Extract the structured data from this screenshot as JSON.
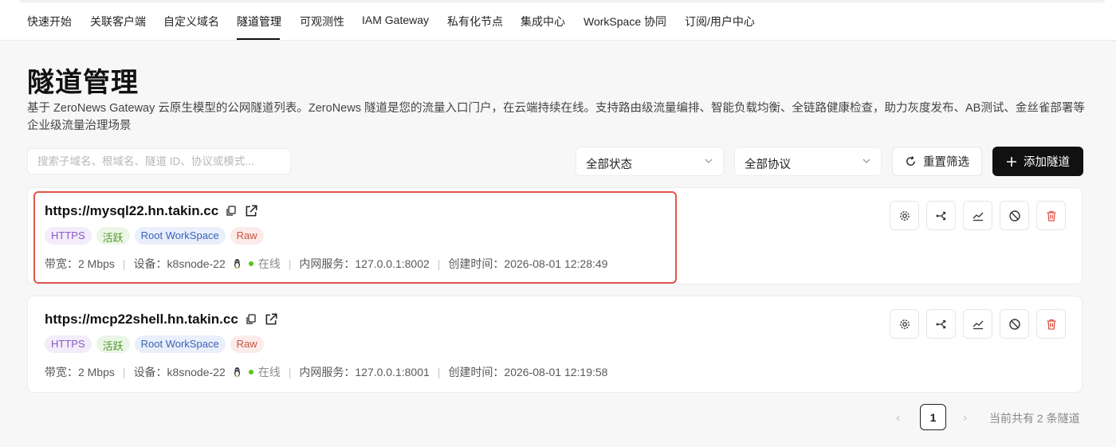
{
  "nav": {
    "tabs": [
      {
        "label": "快速开始"
      },
      {
        "label": "关联客户端"
      },
      {
        "label": "自定义域名"
      },
      {
        "label": "隧道管理",
        "active": true
      },
      {
        "label": "可观测性"
      },
      {
        "label": "IAM Gateway"
      },
      {
        "label": "私有化节点"
      },
      {
        "label": "集成中心"
      },
      {
        "label": "WorkSpace 协同"
      },
      {
        "label": "订阅/用户中心"
      }
    ]
  },
  "page": {
    "title": "隧道管理",
    "description": "基于 ZeroNews Gateway 云原生模型的公网隧道列表。ZeroNews 隧道是您的流量入口门户，在云端持续在线。支持路由级流量编排、智能负载均衡、全链路健康检查，助力灰度发布、AB测试、金丝雀部署等企业级流量治理场景"
  },
  "filters": {
    "search_placeholder": "搜索子域名、根域名、隧道 ID、协议或模式...",
    "status_select": "全部状态",
    "protocol_select": "全部协议",
    "reset_label": "重置筛选",
    "add_label": "添加隧道"
  },
  "tunnels": [
    {
      "url": "https://mysql22.hn.takin.cc",
      "tags": [
        "HTTPS",
        "活跃",
        "Root WorkSpace",
        "Raw"
      ],
      "bandwidth": "带宽：2 Mbps",
      "device": "设备：k8snode-22",
      "status": "在线",
      "service": "内网服务：127.0.0.1:8002",
      "created": "创建时间：2026-08-01 12:28:49"
    },
    {
      "url": "https://mcp22shell.hn.takin.cc",
      "tags": [
        "HTTPS",
        "活跃",
        "Root WorkSpace",
        "Raw"
      ],
      "bandwidth": "带宽：2 Mbps",
      "device": "设备：k8snode-22",
      "status": "在线",
      "service": "内网服务：127.0.0.1:8001",
      "created": "创建时间：2026-08-01 12:19:58"
    }
  ],
  "pagination": {
    "prev": "‹",
    "current": "1",
    "next": "›",
    "total_text": "当前共有 2 条隧道"
  },
  "colors": {
    "tag_https_bg": "#f3ecfb",
    "tag_https_fg": "#8a5cc2",
    "tag_active_bg": "#ebf6e6",
    "tag_active_fg": "#4c9a2a",
    "tag_ws_bg": "#e9effb",
    "tag_ws_fg": "#3b62b8",
    "tag_raw_bg": "#fbecea",
    "tag_raw_fg": "#c8503f",
    "online": "#52c41a",
    "danger": "#e0564a",
    "highlight": "#e0564a"
  }
}
